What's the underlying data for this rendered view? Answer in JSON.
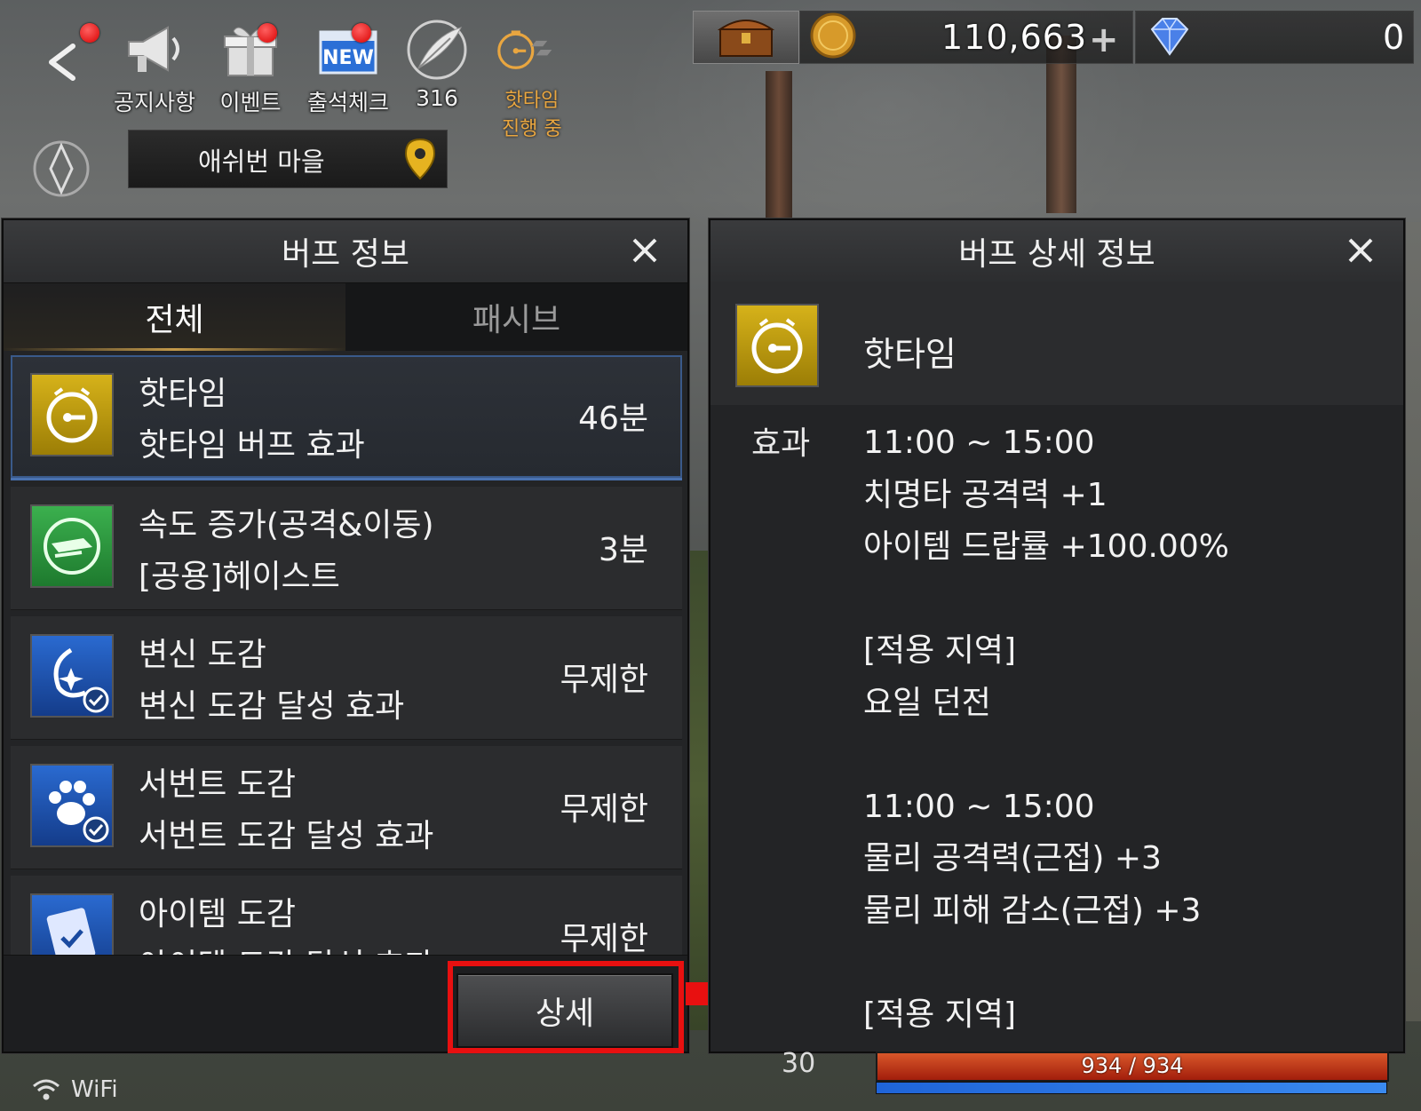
{
  "hud": {
    "notice_label": "공지사항",
    "event_label": "이벤트",
    "attendance_label": "출석체크",
    "attendance_badge": "NEW",
    "feather_count": "316",
    "hottime_label": "핫타임",
    "hottime_status": "진행 중"
  },
  "currency": {
    "gold_amount": "110,663",
    "plus": "+",
    "diamond_amount": "0"
  },
  "location": {
    "name": "애쉬번 마을"
  },
  "buff_panel": {
    "title": "버프 정보",
    "close": "✕",
    "tabs": [
      {
        "label": "전체",
        "active": true
      },
      {
        "label": "패시브",
        "active": false
      }
    ],
    "items": [
      {
        "name": "핫타임",
        "sub": "핫타임 버프 효과",
        "duration": "46분",
        "icon": "hottime-clock-icon",
        "color": "#c9a70c"
      },
      {
        "name": "속도 증가(공격&이동)",
        "sub": "[공용]헤이스트",
        "duration": "3분",
        "icon": "haste-icon",
        "color": "#2e9a3f"
      },
      {
        "name": "변신 도감",
        "sub": "변신 도감 달성 효과",
        "duration": "무제한",
        "icon": "transform-collection-icon",
        "color": "#1e5bb8"
      },
      {
        "name": "서번트 도감",
        "sub": "서번트 도감 달성 효과",
        "duration": "무제한",
        "icon": "servant-collection-icon",
        "color": "#1e5bb8"
      },
      {
        "name": "아이템 도감",
        "sub": "아이템 도감 달성 효과",
        "duration": "무제한",
        "icon": "item-collection-icon",
        "color": "#1e5bb8"
      }
    ],
    "detail_button": "상세"
  },
  "detail_panel": {
    "title": "버프 상세 정보",
    "close": "✕",
    "buff_name": "핫타임",
    "effect_label": "효과",
    "lines": [
      "11:00 ~ 15:00",
      "치명타 공격력 +1",
      "아이템 드랍률 +100.00%",
      "",
      "[적용 지역]",
      "요일 던전",
      "",
      "11:00 ~ 15:00",
      "물리 공격력(근접) +3",
      "물리 피해 감소(근접) +3",
      "",
      "[적용 지역]"
    ]
  },
  "status": {
    "hp_text": "934 / 934",
    "hp_fraction": 1.0,
    "mp_fraction": 1.0,
    "wifi_label": "WiFi",
    "level_partial": "30"
  },
  "colors": {
    "highlight_red": "#e81010",
    "hottime_orange": "#e9a640",
    "selected_border": "#4a72b0"
  }
}
